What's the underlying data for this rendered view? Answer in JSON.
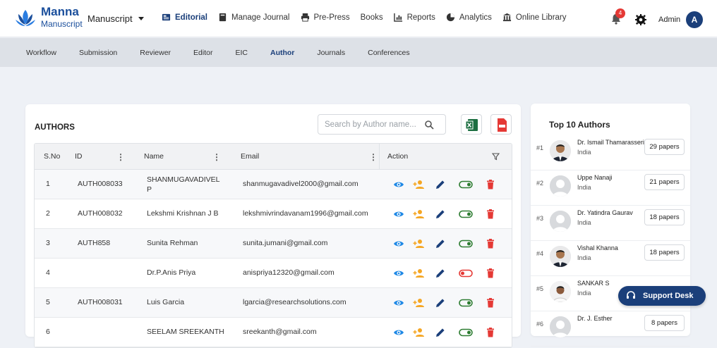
{
  "brand": {
    "name": "Manna",
    "sub": "Manuscript"
  },
  "module_selector": "Manuscript",
  "top_nav": [
    {
      "label": "Editorial",
      "icon": "editorial-icon"
    },
    {
      "label": "Manage Journal",
      "icon": "journal-icon"
    },
    {
      "label": "Pre-Press",
      "icon": "printer-icon"
    },
    {
      "label": "Books",
      "icon": ""
    },
    {
      "label": "Reports",
      "icon": "reports-icon"
    },
    {
      "label": "Analytics",
      "icon": "pie-chart-icon"
    },
    {
      "label": "Online Library",
      "icon": "library-icon"
    }
  ],
  "notifications": {
    "count": "4"
  },
  "user": {
    "name": "Admin",
    "initial": "A"
  },
  "sub_nav": [
    "Workflow",
    "Submission",
    "Reviewer",
    "Editor",
    "EIC",
    "Author",
    "Journals",
    "Conferences"
  ],
  "authors": {
    "title": "AUTHORS",
    "search_placeholder": "Search by Author name...",
    "columns": [
      "S.No",
      "ID",
      "Name",
      "Email",
      "Action"
    ],
    "rows": [
      {
        "sno": "1",
        "id": "AUTH008033",
        "name1": "SHANMUGAVADIVEL",
        "name2": "P",
        "email": "shanmugavadivel2000@gmail.com",
        "active": true
      },
      {
        "sno": "2",
        "id": "AUTH008032",
        "name1": "Lekshmi Krishnan J B",
        "name2": "",
        "email": "lekshmivrindavanam1996@gmail.com",
        "active": true
      },
      {
        "sno": "3",
        "id": "AUTH858",
        "name1": "Sunita Rehman",
        "name2": "",
        "email": "sunita.jumani@gmail.com",
        "active": true
      },
      {
        "sno": "4",
        "id": "",
        "name1": "Dr.P.Anis Priya",
        "name2": "",
        "email": "anispriya12320@gmail.com",
        "active": false
      },
      {
        "sno": "5",
        "id": "AUTH008031",
        "name1": "Luis Garcia",
        "name2": "",
        "email": "lgarcia@researchsolutions.com",
        "active": true
      },
      {
        "sno": "6",
        "id": "",
        "name1": "SEELAM SREEKANTH",
        "name2": "",
        "email": "sreekanth@gmail.com",
        "active": true
      }
    ]
  },
  "top_authors": {
    "title": "Top 10 Authors",
    "items": [
      {
        "rank": "#1",
        "name": "Dr. Ismail Thamarasseri",
        "country": "India",
        "papers": "29 papers",
        "photo": "suit"
      },
      {
        "rank": "#2",
        "name": "Uppe Nanaji",
        "country": "India",
        "papers": "21 papers",
        "photo": "placeholder"
      },
      {
        "rank": "#3",
        "name": "Dr. Yatindra Gaurav",
        "country": "India",
        "papers": "18 papers",
        "photo": "placeholder"
      },
      {
        "rank": "#4",
        "name": "Vishal Khanna",
        "country": "India",
        "papers": "18 papers",
        "photo": "suit"
      },
      {
        "rank": "#5",
        "name": "SANKAR S",
        "country": "India",
        "papers": "",
        "photo": "shirt"
      },
      {
        "rank": "#6",
        "name": "Dr. J. Esther",
        "country": "",
        "papers": "8 papers",
        "photo": "placeholder"
      }
    ]
  },
  "support": {
    "label": "Support Desk"
  },
  "colors": {
    "primary": "#1b3f7a",
    "view": "#1e88e5",
    "assign": "#f5a623",
    "edit": "#1b3f7a",
    "toggle_on": "#2e7d32",
    "toggle_off": "#e53935",
    "delete": "#e53935",
    "excel": "#1d6f42",
    "pdf": "#e53935"
  }
}
